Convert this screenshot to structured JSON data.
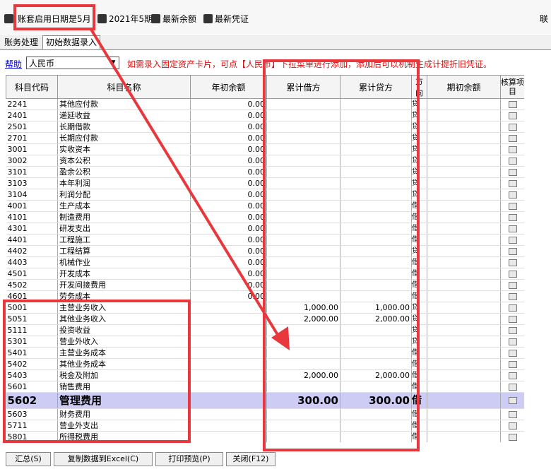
{
  "toolbar": {
    "start_date_text": "账套启用日期是5月",
    "period": "2021年5期",
    "latest_balance": "最新余额",
    "latest_voucher": "最新凭证",
    "right_cut": "联"
  },
  "tabs": [
    "账务处理",
    "初始数据录入"
  ],
  "subbar": {
    "help": "帮助",
    "currency": "人民币",
    "notice": "如需录入固定资产卡片，可点【人民币】下拉菜单进行添加，添加后可以机制生成计提折旧凭证。"
  },
  "table": {
    "headers": [
      "科目代码",
      "科目名称",
      "年初余额",
      "累计借方",
      "累计贷方",
      "方向",
      "期初余额",
      "核算项目"
    ],
    "rows": [
      {
        "code": "2241",
        "name": "其他应付款",
        "open": "0.00",
        "debit": "",
        "credit": "",
        "dir": "贷"
      },
      {
        "code": "2401",
        "name": "递延收益",
        "open": "0.00",
        "debit": "",
        "credit": "",
        "dir": "贷"
      },
      {
        "code": "2501",
        "name": "长期借款",
        "open": "0.00",
        "debit": "",
        "credit": "",
        "dir": "贷"
      },
      {
        "code": "2701",
        "name": "长期应付款",
        "open": "0.00",
        "debit": "",
        "credit": "",
        "dir": "贷"
      },
      {
        "code": "3001",
        "name": "实收资本",
        "open": "0.00",
        "debit": "",
        "credit": "",
        "dir": "贷"
      },
      {
        "code": "3002",
        "name": "资本公积",
        "open": "0.00",
        "debit": "",
        "credit": "",
        "dir": "贷"
      },
      {
        "code": "3101",
        "name": "盈余公积",
        "open": "0.00",
        "debit": "",
        "credit": "",
        "dir": "贷"
      },
      {
        "code": "3103",
        "name": "本年利润",
        "open": "0.00",
        "debit": "",
        "credit": "",
        "dir": "贷"
      },
      {
        "code": "3104",
        "name": "利润分配",
        "open": "0.00",
        "debit": "",
        "credit": "",
        "dir": "贷"
      },
      {
        "code": "4001",
        "name": "生产成本",
        "open": "0.00",
        "debit": "",
        "credit": "",
        "dir": "借"
      },
      {
        "code": "4101",
        "name": "制造费用",
        "open": "0.00",
        "debit": "",
        "credit": "",
        "dir": "借"
      },
      {
        "code": "4301",
        "name": "研发支出",
        "open": "0.00",
        "debit": "",
        "credit": "",
        "dir": "借"
      },
      {
        "code": "4401",
        "name": "工程施工",
        "open": "0.00",
        "debit": "",
        "credit": "",
        "dir": "借"
      },
      {
        "code": "4402",
        "name": "工程结算",
        "open": "0.00",
        "debit": "",
        "credit": "",
        "dir": "贷"
      },
      {
        "code": "4403",
        "name": "机械作业",
        "open": "0.00",
        "debit": "",
        "credit": "",
        "dir": "借"
      },
      {
        "code": "4501",
        "name": "开发成本",
        "open": "0.00",
        "debit": "",
        "credit": "",
        "dir": "借"
      },
      {
        "code": "4502",
        "name": "开发间接费用",
        "open": "0.00",
        "debit": "",
        "credit": "",
        "dir": "借"
      },
      {
        "code": "4601",
        "name": "劳务成本",
        "open": "0.00",
        "debit": "",
        "credit": "",
        "dir": "借"
      },
      {
        "code": "5001",
        "name": "主营业务收入",
        "open": "",
        "debit": "1,000.00",
        "credit": "1,000.00",
        "dir": "贷"
      },
      {
        "code": "5051",
        "name": "其他业务收入",
        "open": "",
        "debit": "2,000.00",
        "credit": "2,000.00",
        "dir": "贷"
      },
      {
        "code": "5111",
        "name": "投资收益",
        "open": "",
        "debit": "",
        "credit": "",
        "dir": "贷"
      },
      {
        "code": "5301",
        "name": "营业外收入",
        "open": "",
        "debit": "",
        "credit": "",
        "dir": "贷"
      },
      {
        "code": "5401",
        "name": "主营业务成本",
        "open": "",
        "debit": "",
        "credit": "",
        "dir": "借"
      },
      {
        "code": "5402",
        "name": "其他业务成本",
        "open": "",
        "debit": "",
        "credit": "",
        "dir": "借"
      },
      {
        "code": "5403",
        "name": "税金及附加",
        "open": "",
        "debit": "2,000.00",
        "credit": "2,000.00",
        "dir": "借"
      },
      {
        "code": "5601",
        "name": "销售费用",
        "open": "",
        "debit": "",
        "credit": "",
        "dir": "借"
      },
      {
        "code": "5602",
        "name": "管理费用",
        "open": "",
        "debit": "300.00",
        "credit": "300.00",
        "dir": "借",
        "selected": true
      },
      {
        "code": "5603",
        "name": "财务费用",
        "open": "",
        "debit": "",
        "credit": "",
        "dir": "借"
      },
      {
        "code": "5711",
        "name": "营业外支出",
        "open": "",
        "debit": "",
        "credit": "",
        "dir": "借"
      },
      {
        "code": "5801",
        "name": "所得税费用",
        "open": "",
        "debit": "",
        "credit": "",
        "dir": "借"
      }
    ]
  },
  "buttons": {
    "summary": "汇总(S)",
    "copy_excel": "复制数据到Excel(C)",
    "print_preview": "打印预览(P)",
    "close": "关闭(F12)"
  },
  "colors": {
    "annotation_red": "#e8383d",
    "selected_row": "#ccccf5"
  }
}
